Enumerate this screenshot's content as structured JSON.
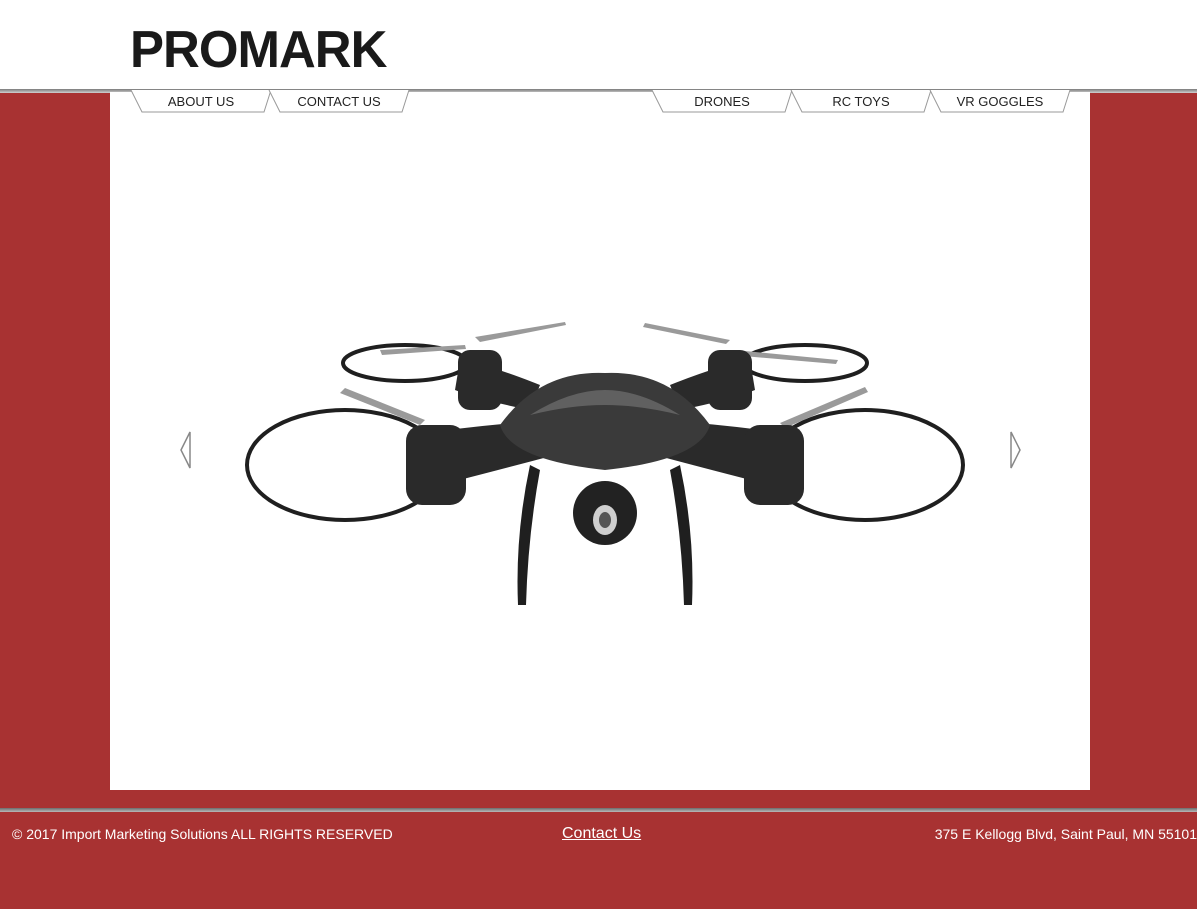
{
  "brand": {
    "logo_text": "PROMARK"
  },
  "nav": {
    "left": [
      {
        "label": "ABOUT US"
      },
      {
        "label": "CONTACT US"
      }
    ],
    "right": [
      {
        "label": "DRONES"
      },
      {
        "label": "RC TOYS"
      },
      {
        "label": "VR GOGGLES"
      }
    ]
  },
  "carousel": {
    "prev_icon": "chevron-left-icon",
    "next_icon": "chevron-right-icon",
    "slide": {
      "image": "quadcopter-drone-image"
    }
  },
  "footer": {
    "copyright": "© 2017 Import Marketing Solutions ALL RIGHTS RESERVED",
    "contact_link": "Contact Us",
    "address": "375 E Kellogg Blvd, Saint Paul, MN 55101"
  },
  "colors": {
    "brand_red": "#a83232",
    "logo_black": "#1a1a1a",
    "background_white": "#ffffff"
  }
}
